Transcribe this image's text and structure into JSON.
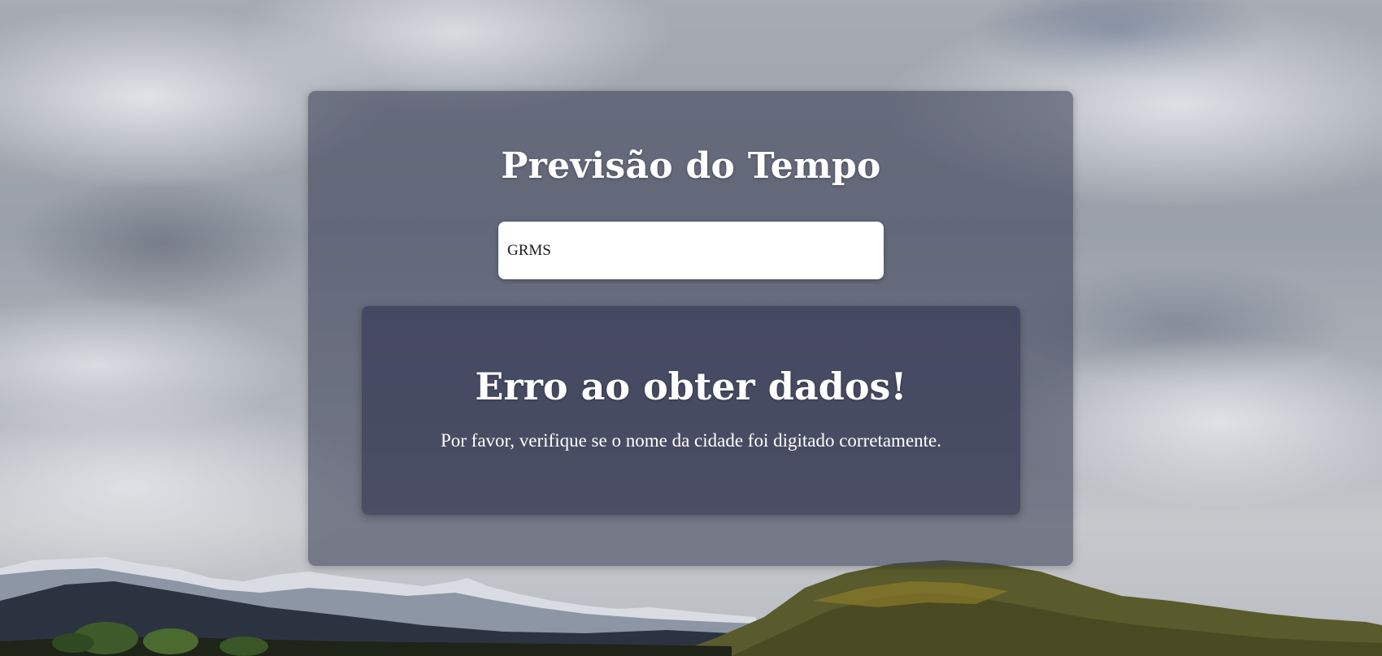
{
  "header": {
    "title": "Previsão do Tempo"
  },
  "search": {
    "value": "GRMS",
    "placeholder": ""
  },
  "result": {
    "error_title": "Erro ao obter dados!",
    "error_message": "Por favor, verifique se o nome da cidade foi digitado corretamente."
  },
  "colors": {
    "card_overlay": "#343a52",
    "panel_overlay": "#282c48",
    "text": "#ffffff",
    "input_background": "#ffffff"
  },
  "background": {
    "icon": "cloudy-mountain-landscape"
  }
}
